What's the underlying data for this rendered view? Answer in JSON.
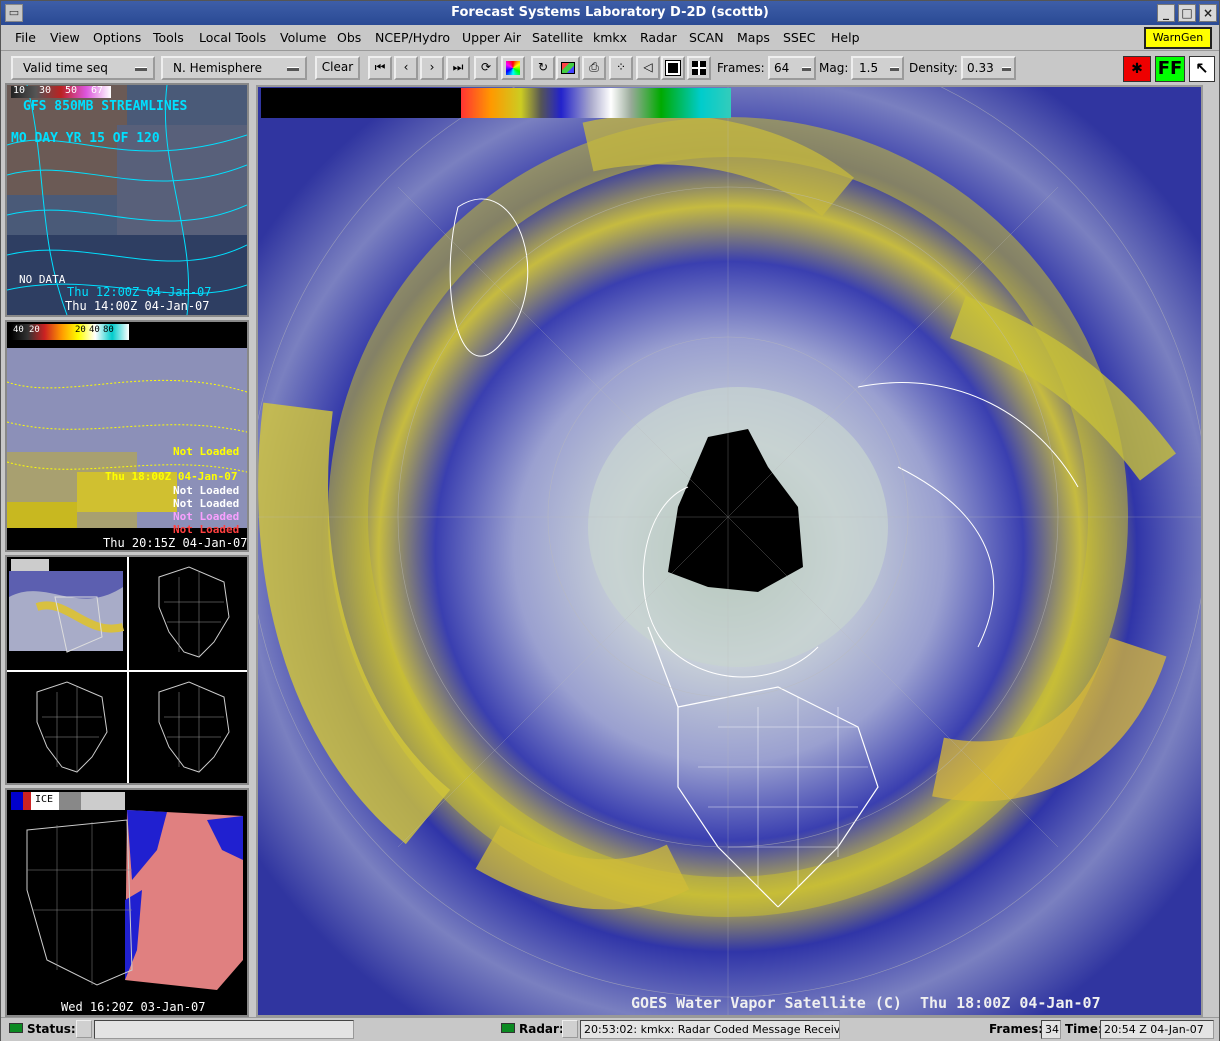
{
  "window": {
    "title": "Forecast Systems Laboratory D-2D (scottb)",
    "min_label": "_",
    "max_label": "□",
    "close_label": "×"
  },
  "menubar": {
    "items": [
      "File",
      "View",
      "Options",
      "Tools",
      "Local Tools",
      "Volume",
      "Obs",
      "NCEP/Hydro",
      "Upper Air",
      "Satellite",
      "kmkx",
      "Radar",
      "SCAN",
      "Maps",
      "SSEC",
      "Help"
    ],
    "warngen_label": "WarnGen"
  },
  "toolbar": {
    "time_mode": "Valid time seq",
    "projection": "N. Hemisphere",
    "clear_label": "Clear",
    "frames_label": "Frames:",
    "frames_value": "64",
    "mag_label": "Mag:",
    "mag_value": "1.5",
    "density_label": "Density:",
    "density_value": "0.33",
    "icons": [
      "first-frame-icon",
      "prev-frame-icon",
      "next-frame-icon",
      "last-frame-icon",
      "loop-icon",
      "color-table-icon",
      "rotate-icon",
      "image-icon",
      "print-icon",
      "dots-icon",
      "arrow-icon",
      "panel-one-icon",
      "panel-four-icon"
    ],
    "ff_label": "FF"
  },
  "side_panes": {
    "pane1": {
      "title1": "GFS 850MB STREAMLINES",
      "title2": "MO DAY YR 15 OF 120",
      "nodata": "NO DATA",
      "time_a": "Thu 12:00Z 04-Jan-07",
      "time": "Thu 14:00Z 04-Jan-07",
      "scale_nums": [
        "10",
        "30",
        "50",
        "67"
      ]
    },
    "pane2": {
      "scale_nums": [
        "40",
        "20",
        "20",
        "40",
        "80"
      ],
      "nl1": "Not Loaded",
      "time_a": "Thu 18:00Z 04-Jan-07",
      "nl2": "Not Loaded",
      "nl3": "Not Loaded",
      "nl4": "Not Loaded",
      "nl5": "Not Loaded",
      "time": "Thu 20:15Z 04-Jan-07"
    },
    "pane4": {
      "legend": "ICE",
      "time": "Wed 16:20Z 03-Jan-07"
    }
  },
  "main": {
    "label": "GOES Water Vapor Satellite (C)  Thu 18:00Z 04-Jan-07"
  },
  "statusbar": {
    "status_label": "Status:",
    "radar_label": "Radar:",
    "radar_message": "20:53:02: kmkx: Radar Coded Message Receiv",
    "frames_label": "Frames:",
    "frames_value": "34",
    "time_label": "Time:",
    "time_value": "20:54 Z 04-Jan-07"
  },
  "colors": {
    "title_bg": "#2a4a94",
    "warngen_bg": "#ffff00",
    "ff_bg": "#00ff00",
    "led_green": "#0b8a22"
  }
}
